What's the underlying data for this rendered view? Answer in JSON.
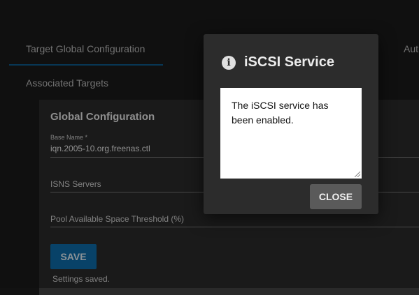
{
  "tabs": {
    "global": "Target Global Configuration",
    "associated": "Associated Targets",
    "right_partial": "Aut"
  },
  "form": {
    "title": "Global Configuration",
    "base_name_label": "Base Name *",
    "base_name_value": "iqn.2005-10.org.freenas.ctl",
    "isns_label": "ISNS Servers",
    "pool_label": "Pool Available Space Threshold (%)",
    "save_label": "SAVE",
    "status": "Settings saved."
  },
  "dialog": {
    "title": "iSCSI Service",
    "message": "The iSCSI service has been enabled.",
    "close_label": "CLOSE",
    "icon": "info-icon"
  },
  "colors": {
    "accent": "#0d6ba8",
    "background": "#1a1a1a",
    "dialog": "#2c2c2c"
  }
}
